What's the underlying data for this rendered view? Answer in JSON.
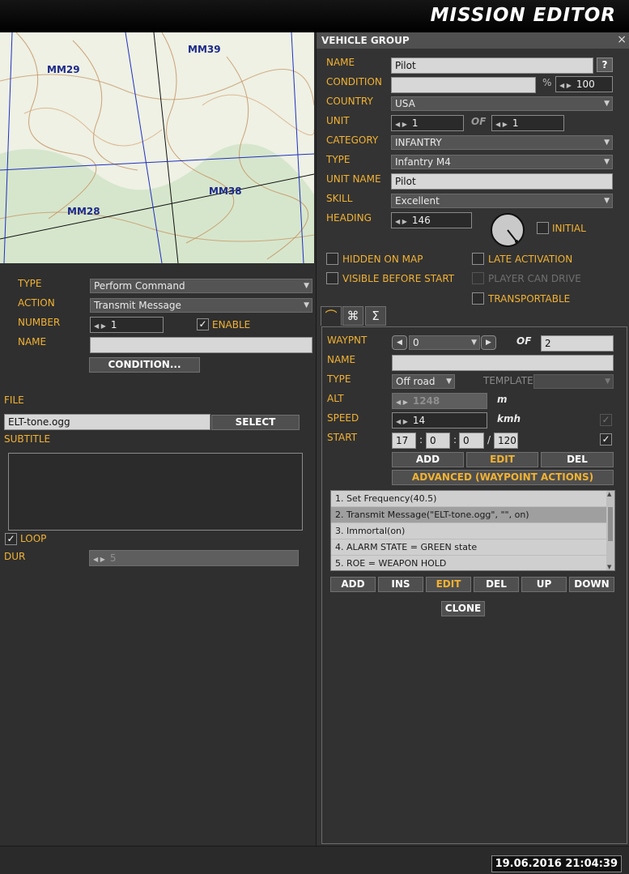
{
  "app": {
    "title": "MISSION EDITOR"
  },
  "map": {
    "labels": [
      "MM39",
      "MM29",
      "MM38",
      "MM28"
    ]
  },
  "trigger": {
    "type_label": "TYPE",
    "type_value": "Perform Command",
    "action_label": "ACTION",
    "action_value": "Transmit Message",
    "number_label": "NUMBER",
    "number_value": "1",
    "enable_label": "ENABLE",
    "enable_checked": true,
    "name_label": "NAME",
    "name_value": "",
    "condition_button": "CONDITION...",
    "file_label": "FILE",
    "file_value": "ELT-tone.ogg",
    "select_button": "SELECT",
    "subtitle_label": "SUBTITLE",
    "subtitle_value": "",
    "loop_label": "LOOP",
    "loop_checked": true,
    "dur_label": "DUR",
    "dur_value": "5"
  },
  "vehicle_group": {
    "panel_title": "VEHICLE GROUP",
    "close_icon": "×",
    "help_icon": "?",
    "name_label": "NAME",
    "name_value": "Pilot",
    "condition_label": "CONDITION",
    "condition_value": "",
    "percent_sign": "%",
    "percent_value": "100",
    "country_label": "COUNTRY",
    "country_value": "USA",
    "unit_label": "UNIT",
    "unit_value": "1",
    "of_label": "OF",
    "unit_of_value": "1",
    "category_label": "CATEGORY",
    "category_value": "INFANTRY",
    "type_label": "TYPE",
    "type_value": "Infantry M4",
    "unit_name_label": "UNIT NAME",
    "unit_name_value": "Pilot",
    "skill_label": "SKILL",
    "skill_value": "Excellent",
    "heading_label": "HEADING",
    "heading_value": "146",
    "initial_label": "INITIAL",
    "hidden_on_map_label": "HIDDEN ON MAP",
    "late_activation_label": "LATE ACTIVATION",
    "visible_before_start_label": "VISIBLE BEFORE START",
    "player_can_drive_label": "PLAYER CAN DRIVE",
    "transportable_label": "TRANSPORTABLE"
  },
  "tabs": [
    {
      "icon": "route-icon",
      "glyph": "⌒"
    },
    {
      "icon": "command-icon",
      "glyph": "⌘"
    },
    {
      "icon": "sigma-icon",
      "glyph": "Σ"
    }
  ],
  "waypoint": {
    "waypnt_label": "WAYPNT",
    "waypnt_value": "0",
    "of_label": "OF",
    "waypnt_of_value": "2",
    "name_label": "NAME",
    "name_value": "",
    "type_label": "TYPE",
    "type_value": "Off road",
    "template_label": "TEMPLATE",
    "template_value": "",
    "alt_label": "ALT",
    "alt_value": "1248",
    "alt_unit": "m",
    "speed_label": "SPEED",
    "speed_value": "14",
    "speed_unit": "kmh",
    "start_label": "START",
    "start_h": "17",
    "start_m": "0",
    "start_s": "0",
    "start_d": "120",
    "colon": ":",
    "slash": "/",
    "add_button": "ADD",
    "edit_button": "EDIT",
    "del_button": "DEL",
    "advanced_button": "ADVANCED (WAYPOINT ACTIONS)",
    "actions": [
      "1. Set Frequency(40.5)",
      "2. Transmit Message(\"ELT-tone.ogg\", \"\", on)",
      "3. Immortal(on)",
      "4. ALARM STATE = GREEN state",
      "5. ROE = WEAPON HOLD"
    ],
    "selected_action": 1,
    "list_buttons": {
      "add": "ADD",
      "ins": "INS",
      "edit": "EDIT",
      "del": "DEL",
      "up": "UP",
      "down": "DOWN"
    },
    "clone_button": "CLONE"
  },
  "status": {
    "datetime": "19.06.2016 21:04:39"
  },
  "colors": {
    "accent": "#f2b232",
    "panel": "#333333",
    "background": "#2f2f2f"
  }
}
